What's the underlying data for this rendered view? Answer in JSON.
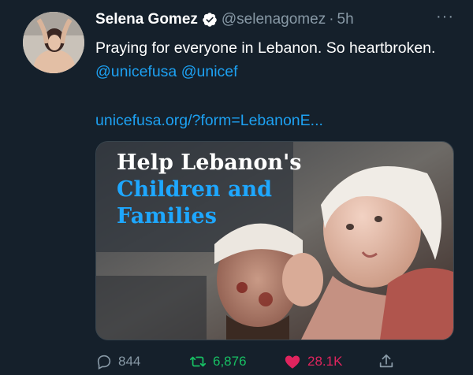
{
  "tweet": {
    "author_name": "Selena Gomez",
    "handle": "@selenagomez",
    "separator": "·",
    "time": "5h",
    "more_label": "···",
    "text_main": "Praying for everyone in Lebanon. So heartbroken. ",
    "mention1": "@unicefusa",
    "mention2": "@unicef",
    "link": "unicefusa.org/?form=LebanonE...",
    "card": {
      "line1": "Help Lebanon's",
      "line2": "Children and",
      "line3": "Families"
    }
  },
  "actions": {
    "reply_count": "844",
    "retweet_count": "6,876",
    "like_count": "28.1K"
  },
  "colors": {
    "background": "#15202b",
    "link": "#1da1f2",
    "retweet": "#17bf63",
    "like": "#e0245e",
    "muted": "#8899a6"
  },
  "icons": [
    "verified-badge-icon",
    "more-icon",
    "reply-icon",
    "retweet-icon",
    "heart-icon",
    "share-icon"
  ]
}
